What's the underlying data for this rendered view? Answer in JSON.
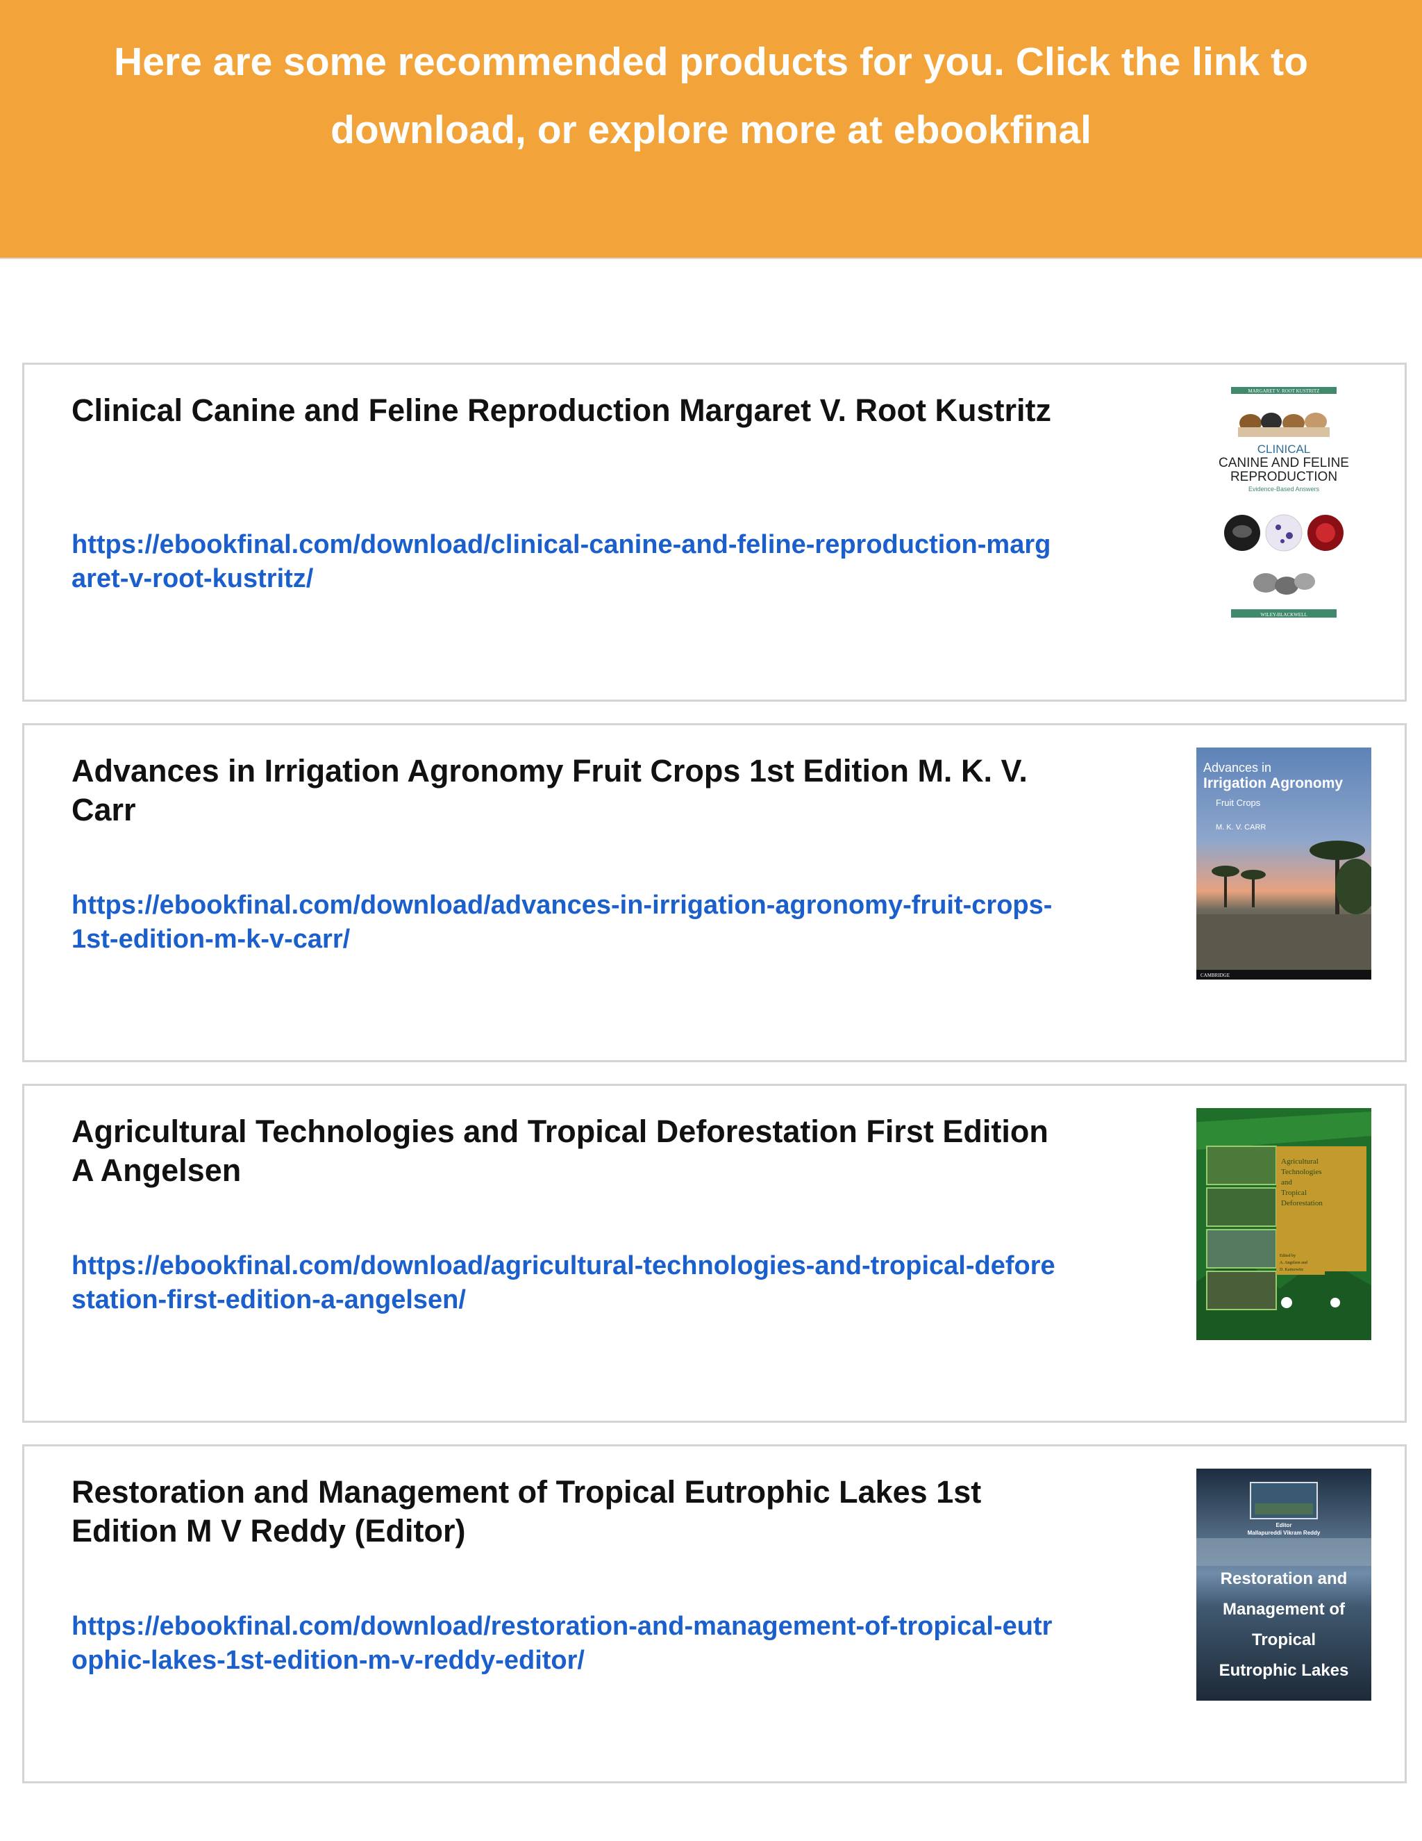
{
  "banner": {
    "line1": "Here are some recommended products for you. Click the link to",
    "line2": "download, or explore more at ebookfinal"
  },
  "products": [
    {
      "title": "Clinical Canine and Feline Reproduction Margaret V. Root Kustritz",
      "link": "https://ebookfinal.com/download/clinical-canine-and-feline-reproduction-margaret-v-root-kustritz/",
      "cover": {
        "top_band": "MARGARET V. ROOT KUSTRITZ",
        "line1": "CLINICAL",
        "line2": "CANINE AND FELINE",
        "line3": "REPRODUCTION",
        "subtitle": "Evidence-Based Answers",
        "publisher": "WILEY-BLACKWELL"
      }
    },
    {
      "title": "Advances in Irrigation Agronomy Fruit Crops 1st Edition M. K. V. Carr",
      "link": "https://ebookfinal.com/download/advances-in-irrigation-agronomy-fruit-crops-1st-edition-m-k-v-carr/",
      "cover": {
        "line1": "Advances in",
        "line2": "Irrigation Agronomy",
        "line3": "Fruit Crops",
        "author": "M. K. V. CARR",
        "publisher": "CAMBRIDGE"
      }
    },
    {
      "title": "Agricultural Technologies and Tropical Deforestation First Edition A Angelsen",
      "link": "https://ebookfinal.com/download/agricultural-technologies-and-tropical-deforestation-first-edition-a-angelsen/",
      "cover": {
        "line1": "Agricultural",
        "line2": "Technologies",
        "line3": "and",
        "line4": "Tropical",
        "line5": "Deforestation",
        "editors_line1": "Edited by",
        "editors_line2": "A. Angelsen and",
        "editors_line3": "D. Kaimowitz"
      }
    },
    {
      "title": "Restoration and Management of Tropical Eutrophic Lakes 1st Edition M V Reddy (Editor)",
      "link": "https://ebookfinal.com/download/restoration-and-management-of-tropical-eutrophic-lakes-1st-edition-m-v-reddy-editor/",
      "cover": {
        "editor_label": "Editor",
        "editor_name": "Mallapureddi Vikram Reddy",
        "line1": "Restoration and",
        "line2": "Management of",
        "line3": "Tropical",
        "line4": "Eutrophic Lakes"
      }
    }
  ]
}
